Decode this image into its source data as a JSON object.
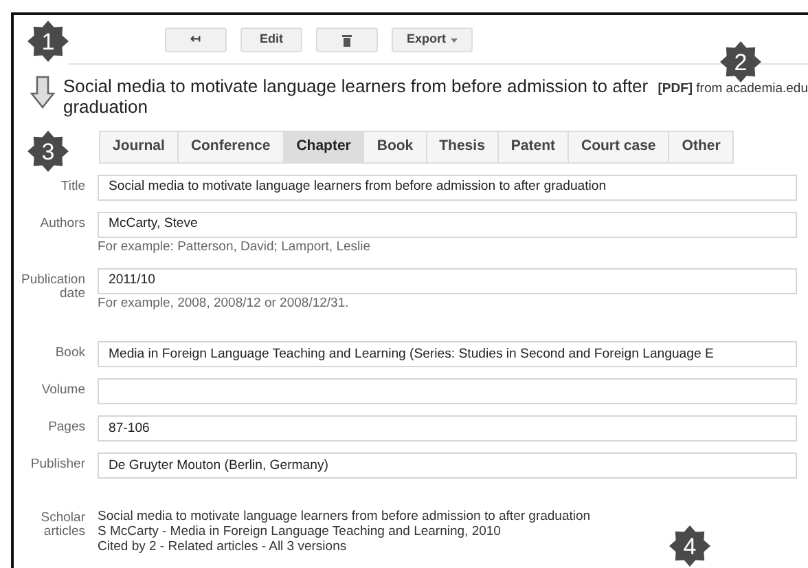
{
  "toolbar": {
    "buttons": [
      {
        "kind": "back",
        "label": "↤"
      },
      {
        "kind": "text",
        "label": "Edit"
      },
      {
        "kind": "trash"
      },
      {
        "kind": "dropdown",
        "label": "Export"
      }
    ]
  },
  "article": {
    "title": "Social media to motivate language learners from before admission to after graduation",
    "pdf_tag": "[PDF]",
    "pdf_source": "from academia.edu"
  },
  "tabs": [
    {
      "label": "Journal",
      "selected": false
    },
    {
      "label": "Conference",
      "selected": false
    },
    {
      "label": "Chapter",
      "selected": true
    },
    {
      "label": "Book",
      "selected": false
    },
    {
      "label": "Thesis",
      "selected": false
    },
    {
      "label": "Patent",
      "selected": false
    },
    {
      "label": "Court case",
      "selected": false
    },
    {
      "label": "Other",
      "selected": false
    }
  ],
  "fields": [
    {
      "label": "Title",
      "value": "Social media to motivate language learners from before admission to after graduation"
    },
    {
      "label": "Authors",
      "value": "McCarty, Steve",
      "hint": "For example: Patterson, David; Lamport, Leslie"
    },
    {
      "label": "Publication date",
      "value": "2011/10",
      "hint": "For example, 2008, 2008/12 or 2008/12/31."
    },
    {
      "label": "Book",
      "value": "Media in Foreign Language Teaching and Learning (Series: Studies in Second and Foreign Language E"
    },
    {
      "label": "Volume"
    },
    {
      "label": "Pages",
      "value": "87-106"
    },
    {
      "label": "Publisher",
      "value": "De Gruyter Mouton (Berlin, Germany)"
    }
  ],
  "scholar_articles": {
    "label": "Scholar articles",
    "lines": [
      "Social media to motivate language learners from before admission to after graduation",
      "S McCarty - Media in Foreign Language Teaching and Learning, 2010",
      "Cited by 2 - Related articles - All 3 versions"
    ]
  },
  "callouts": [
    {
      "number": "1"
    },
    {
      "number": "2"
    },
    {
      "number": "3"
    },
    {
      "number": "4"
    }
  ]
}
